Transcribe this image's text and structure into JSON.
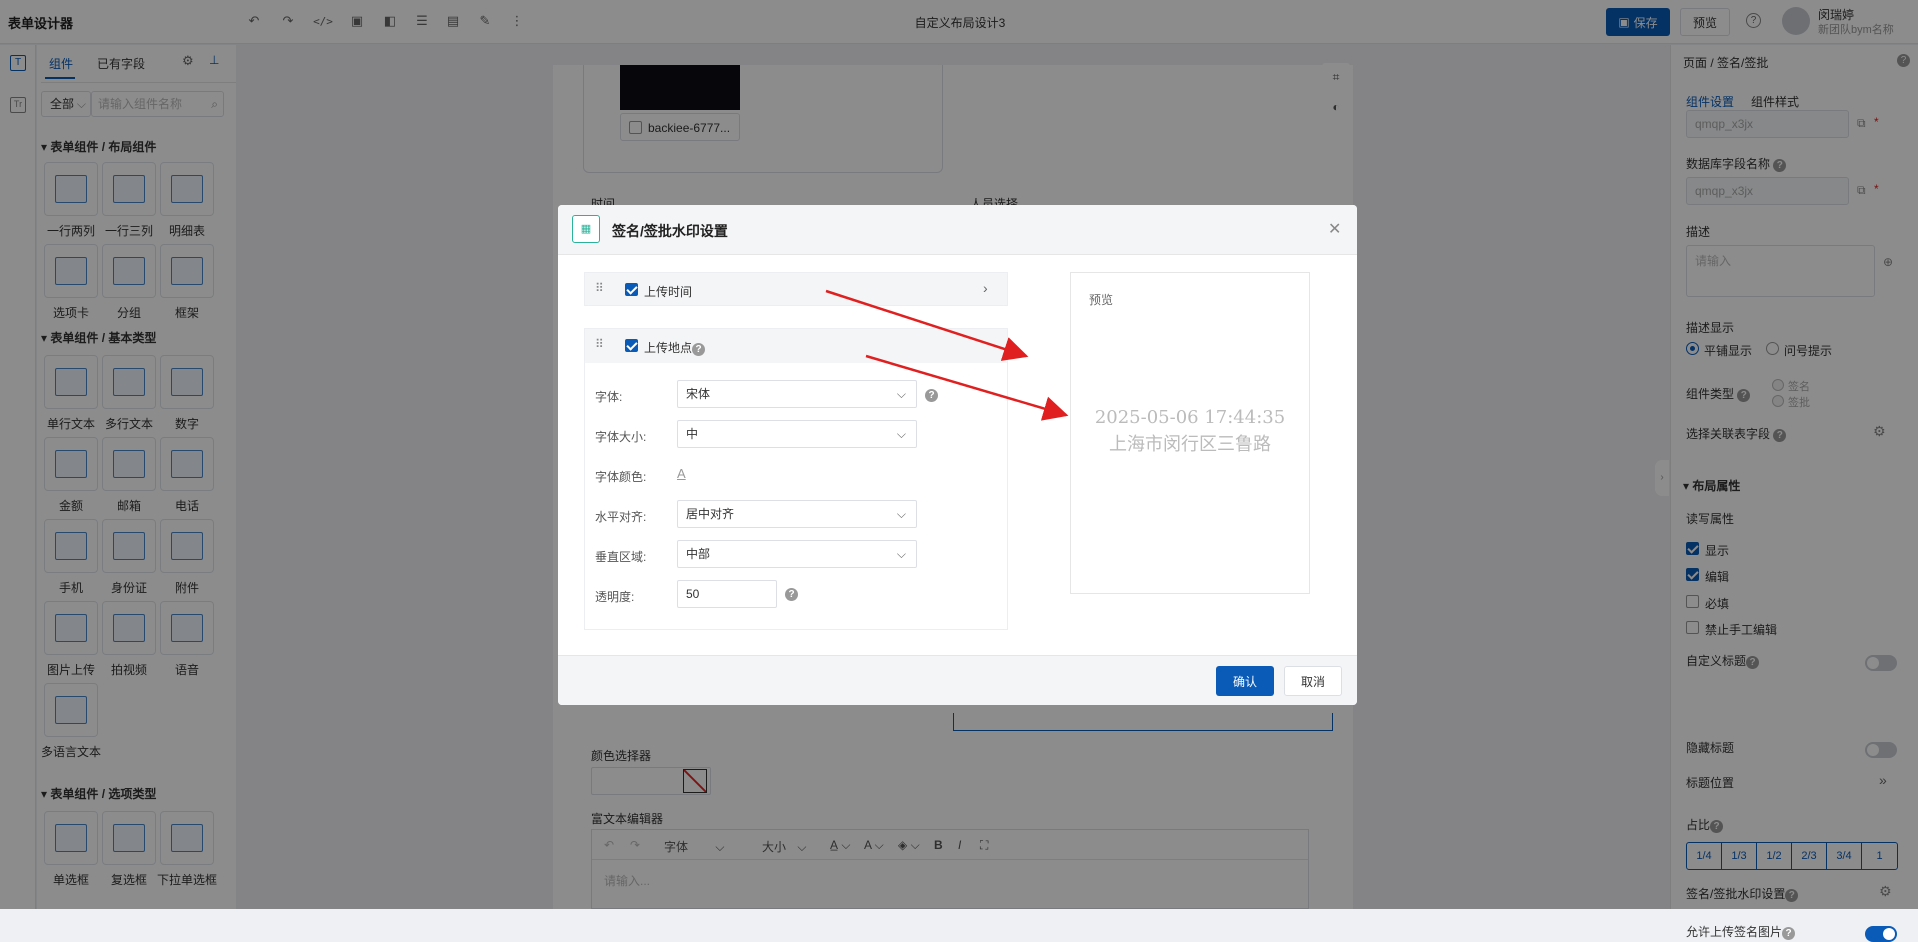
{
  "app": {
    "title": "表单设计器",
    "doc_title": "自定义布局设计3",
    "save": "保存",
    "preview": "预览",
    "user_name": "闵瑞婷",
    "user_org": "新团队bym名称"
  },
  "left": {
    "tab_components": "组件",
    "tab_fields": "已有字段",
    "filter": "全部",
    "search_placeholder": "请输入组件名称",
    "sec1": "表单组件 / 布局组件",
    "sec2": "表单组件 / 基本类型",
    "sec3": "表单组件 / 选项类型",
    "layout": [
      "一行两列",
      "一行三列",
      "明细表",
      "选项卡",
      "分组",
      "框架"
    ],
    "basic": [
      "单行文本",
      "多行文本",
      "数字",
      "金额",
      "邮箱",
      "电话",
      "手机",
      "身份证",
      "附件",
      "图片上传",
      "拍视频",
      "语音",
      "多语言文本"
    ],
    "choice": [
      "单选框",
      "复选框",
      "下拉单选框"
    ],
    "number_icon_text": "123"
  },
  "canvas": {
    "file_name": "backiee-6777...",
    "label_time": "时间",
    "label_person": "人员选择",
    "label_color": "颜色选择器",
    "label_richtext": "富文本编辑器",
    "rt_font": "字体",
    "rt_size": "大小",
    "rt_placeholder": "请输入..."
  },
  "dialog": {
    "title": "签名/签批水印设置",
    "item1": "上传时间",
    "item2": "上传地点",
    "font_label": "字体:",
    "font_value": "宋体",
    "size_label": "字体大小:",
    "size_value": "中",
    "color_label": "字体颜色:",
    "color_glyph": "A",
    "halign_label": "水平对齐:",
    "halign_value": "居中对齐",
    "valign_label": "垂直区域:",
    "valign_value": "中部",
    "opacity_label": "透明度:",
    "opacity_value": "50",
    "preview_label": "预览",
    "preview_line1": "2025-05-06 17:44:35",
    "preview_line2": "上海市闵行区三鲁路",
    "confirm": "确认",
    "cancel": "取消"
  },
  "right": {
    "breadcrumb": "页面 / 签名/签批",
    "tab_settings": "组件设置",
    "tab_style": "组件样式",
    "field_code": "qmqp_x3jx",
    "db_label": "数据库字段名称",
    "db_value": "qmqp_x3jx",
    "desc_label": "描述",
    "desc_placeholder": "请输入",
    "desc_display": "描述显示",
    "opt_flat": "平铺显示",
    "opt_tip": "问号提示",
    "type_label": "组件类型",
    "type_sign": "签名",
    "type_approve": "签批",
    "assoc_label": "选择关联表字段",
    "layout_title": "布局属性",
    "rw_label": "读写属性",
    "cb_show": "显示",
    "cb_edit": "编辑",
    "cb_required": "必填",
    "cb_noedit": "禁止手工编辑",
    "custom_title": "自定义标题",
    "hide_title": "隐藏标题",
    "title_pos": "标题位置",
    "ratio": "占比",
    "ratios": [
      "1/4",
      "1/3",
      "1/2",
      "2/3",
      "3/4",
      "1"
    ],
    "watermark": "签名/签批水印设置",
    "allow_upload": "允许上传签名图片"
  },
  "colors": {
    "primary": "#0a5bb8",
    "arrow": "#e02020"
  }
}
